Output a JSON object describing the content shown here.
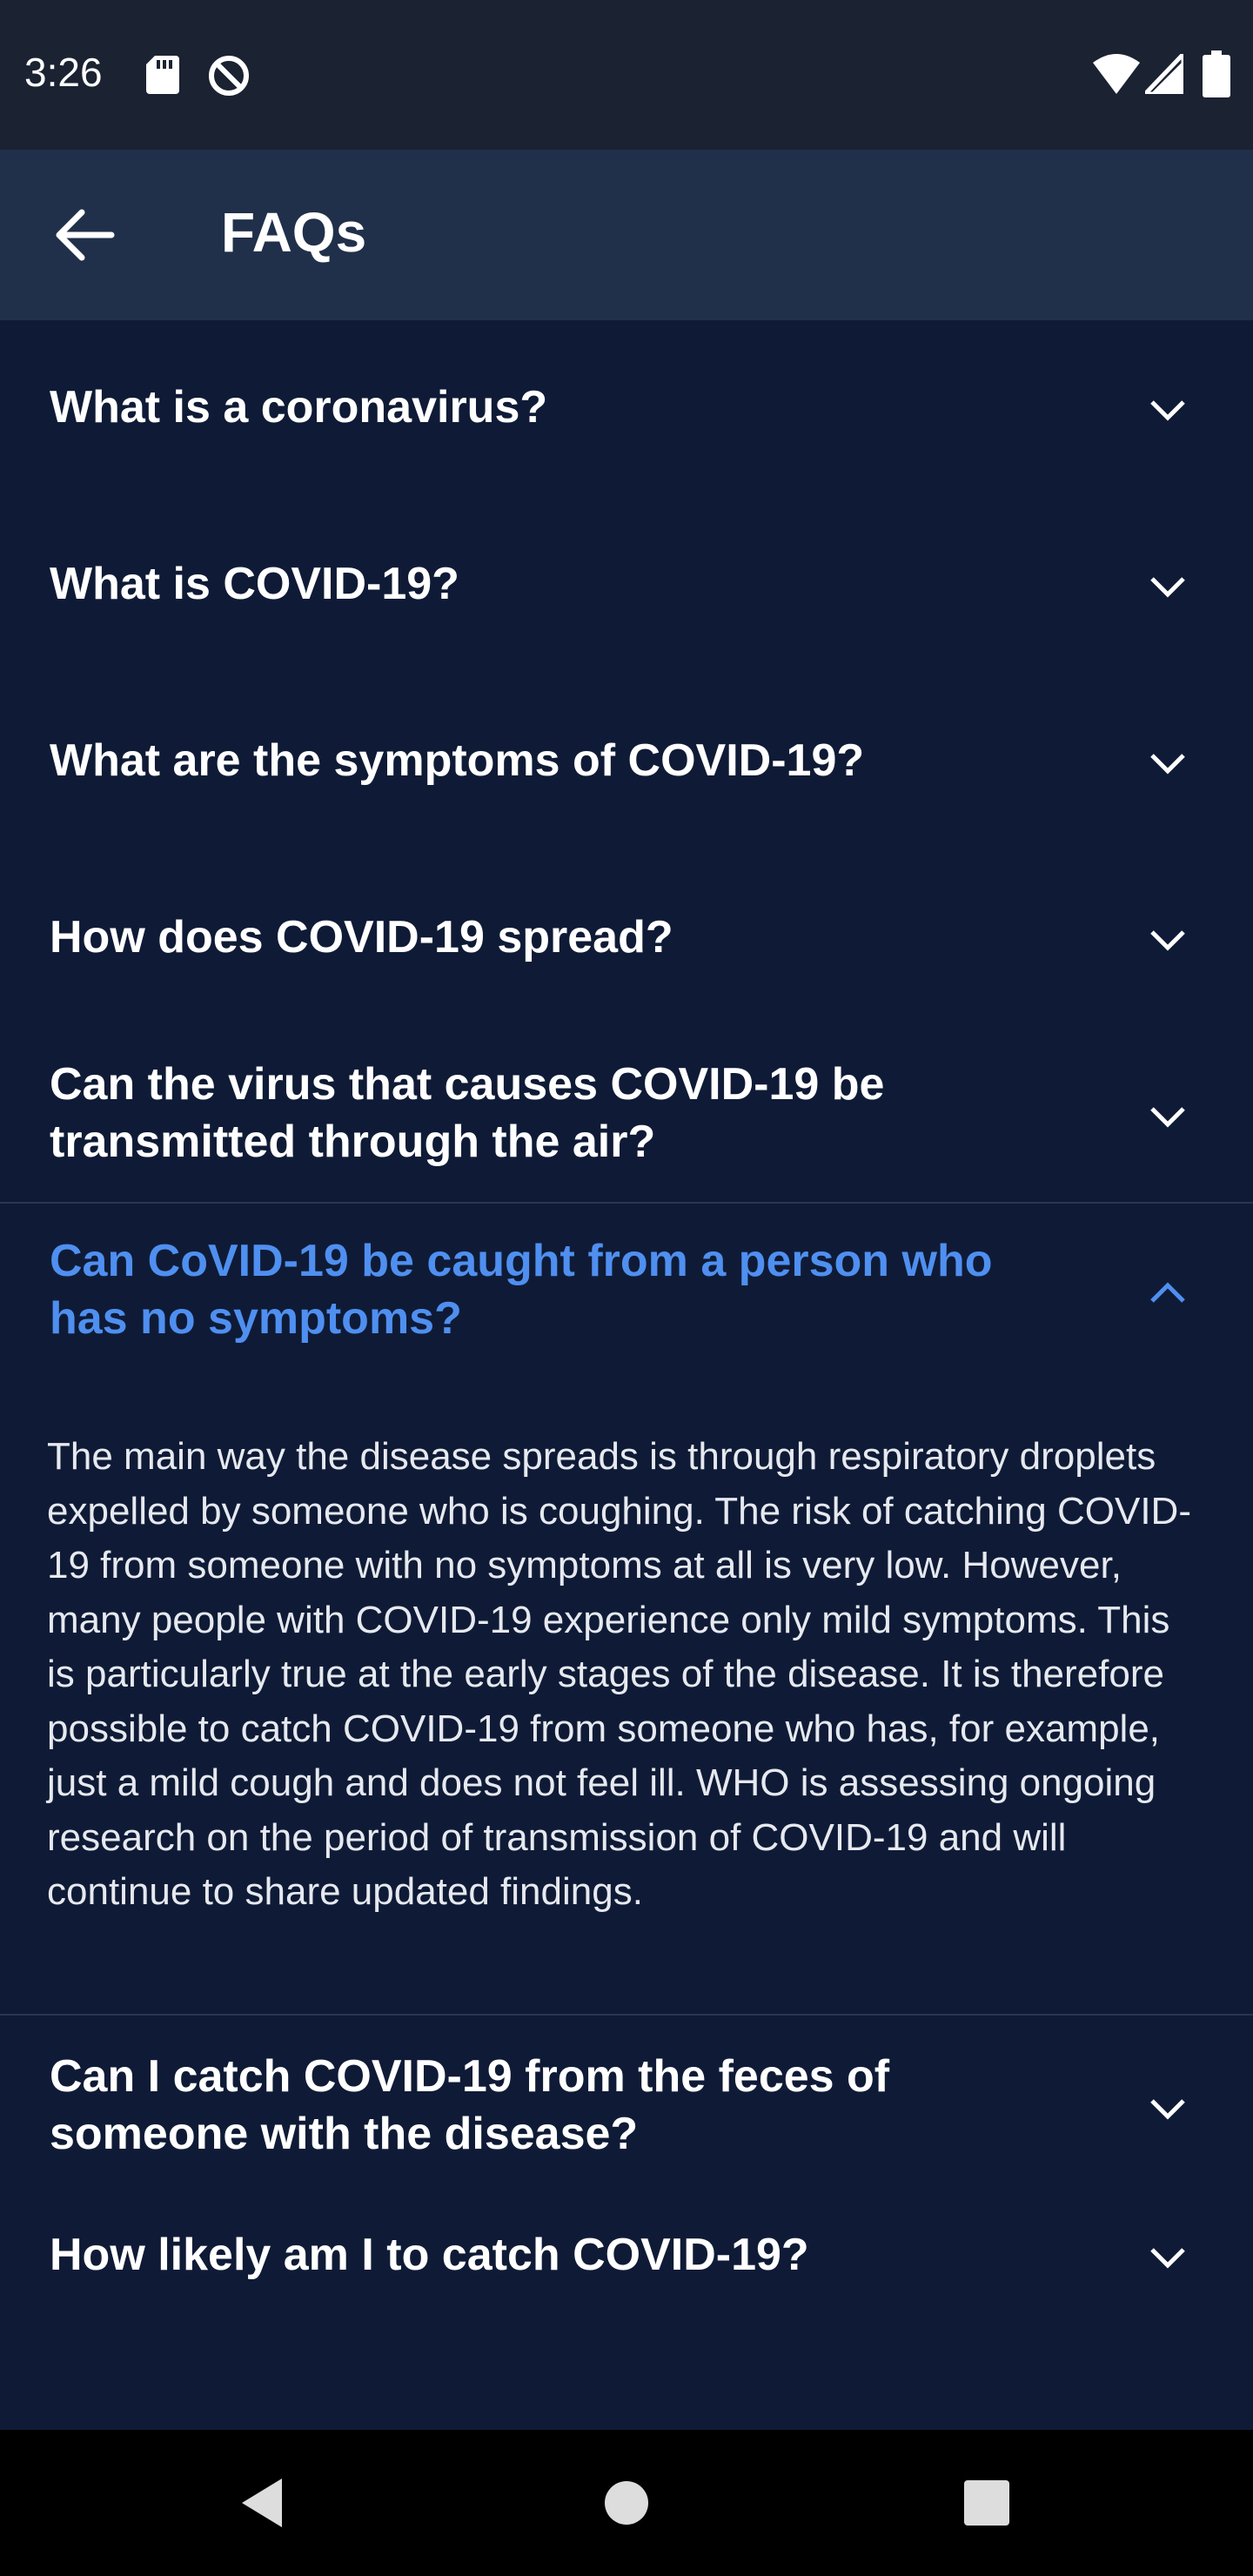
{
  "status_bar": {
    "time": "3:26"
  },
  "app_bar": {
    "title": "FAQs"
  },
  "faqs": [
    {
      "question": "What is a coronavirus?",
      "expanded": false
    },
    {
      "question": "What is COVID-19?",
      "expanded": false
    },
    {
      "question": "What are the symptoms of COVID-19?",
      "expanded": false
    },
    {
      "question": "How does COVID-19 spread?",
      "expanded": false
    },
    {
      "question": "Can the virus that causes COVID-19 be transmitted through the air?",
      "expanded": false
    },
    {
      "question": "Can CoVID-19 be caught from a person who has no symptoms?",
      "expanded": true,
      "answer": "The main way the disease spreads is through respiratory droplets expelled by someone who is coughing. The risk of catching COVID-19 from someone with no symptoms at all is very low. However, many people with COVID-19 experience only mild symptoms. This is particularly true at the early stages of the disease. It is therefore possible to catch COVID-19 from someone who has, for example, just a mild cough and does not feel ill.  WHO is assessing ongoing research on the period of transmission of COVID-19 and will continue to share updated findings."
    },
    {
      "question": "Can I catch COVID-19 from the feces of someone with the disease?",
      "expanded": false
    },
    {
      "question": "How likely am I to catch COVID-19?",
      "expanded": false
    }
  ],
  "colors": {
    "background": "#0f1b36",
    "app_bar": "#20304a",
    "status_bar": "#1b2232",
    "accent": "#4f8ff0",
    "text": "#ffffff"
  },
  "icons": {
    "back": "arrow-left-icon",
    "collapsed": "chevron-down-icon",
    "expanded": "chevron-up-icon"
  }
}
